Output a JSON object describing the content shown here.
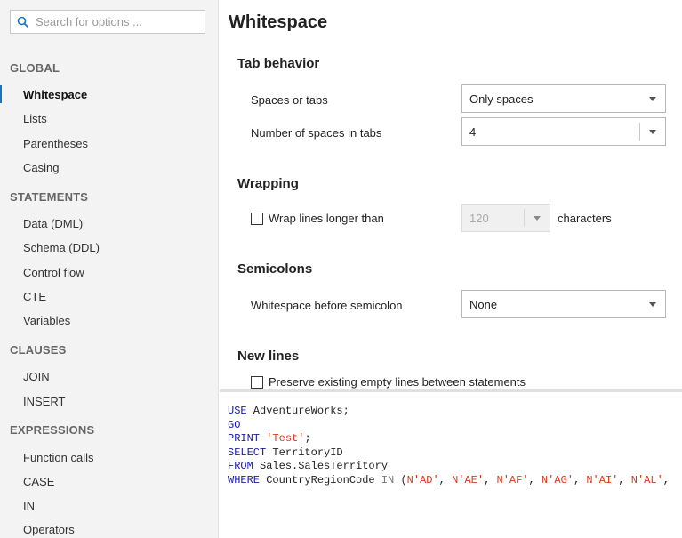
{
  "search": {
    "placeholder": "Search for options ..."
  },
  "sidebar": {
    "sections": [
      {
        "title": "GLOBAL",
        "items": [
          "Whitespace",
          "Lists",
          "Parentheses",
          "Casing"
        ]
      },
      {
        "title": "STATEMENTS",
        "items": [
          "Data (DML)",
          "Schema (DDL)",
          "Control flow",
          "CTE",
          "Variables"
        ]
      },
      {
        "title": "CLAUSES",
        "items": [
          "JOIN",
          "INSERT"
        ]
      },
      {
        "title": "EXPRESSIONS",
        "items": [
          "Function calls",
          "CASE",
          "IN",
          "Operators"
        ]
      }
    ],
    "active_item": "Whitespace"
  },
  "main": {
    "title": "Whitespace",
    "tab_behavior": {
      "heading": "Tab behavior",
      "spaces_or_tabs_label": "Spaces or tabs",
      "spaces_or_tabs_value": "Only spaces",
      "num_spaces_label": "Number of spaces in tabs",
      "num_spaces_value": "4"
    },
    "wrapping": {
      "heading": "Wrapping",
      "wrap_label": "Wrap lines longer than",
      "wrap_checked": false,
      "wrap_value": "120",
      "wrap_suffix": "characters"
    },
    "semicolons": {
      "heading": "Semicolons",
      "ws_before_label": "Whitespace before semicolon",
      "ws_before_value": "None"
    },
    "new_lines": {
      "heading": "New lines",
      "preserve_label": "Preserve existing empty lines between statements",
      "preserve_checked": false
    }
  },
  "code_preview": {
    "line1_kw": "USE",
    "line1_rest": " AdventureWorks;",
    "line2_kw": "GO",
    "line3_kw": "PRINT",
    "line3_str": "'Test'",
    "line3_end": ";",
    "line4_kw": "SELECT",
    "line4_rest": " TerritoryID",
    "line5_kw": "FROM",
    "line5_rest": " Sales.SalesTerritory",
    "line6_kw": "WHERE",
    "line6_mid": " CountryRegionCode ",
    "line6_in": "IN",
    "line6_paren": " (",
    "line6_v1": "N'AD'",
    "line6_v2": "N'AE'",
    "line6_v3": "N'AF'",
    "line6_v4": "N'AG'",
    "line6_v5": "N'AI'",
    "line6_v6": "N'AL'",
    "comma": ", "
  }
}
